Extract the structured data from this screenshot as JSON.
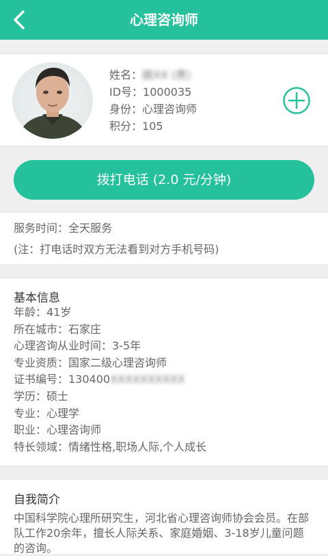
{
  "header": {
    "title": "心理咨询师"
  },
  "profile": {
    "name_label": "姓名：",
    "name_value": "姚XX (男)",
    "id_label": "ID号：",
    "id_value": "1000035",
    "identity_label": "身份：",
    "identity_value": "心理咨询师",
    "points_label": "积分：",
    "points_value": "105"
  },
  "call_button": {
    "label": "拨打电话 (2.0 元/分钟)"
  },
  "service": {
    "time_line": "服务时间：全天服务",
    "note_line": "(注：打电话时双方无法看到对方手机号码)"
  },
  "basic_info": {
    "title": "基本信息",
    "age": "年龄：41岁",
    "city": "所在城市：石家庄",
    "experience": "心理咨询从业时间：3-5年",
    "qualification": "专业资质：国家二级心理咨询师",
    "cert_label": "证书编号：130400",
    "cert_hidden": "XXXXXXXXXX",
    "education": "学历：硕士",
    "major": "专业：心理学",
    "occupation": "职业：心理咨询师",
    "specialty": "特长领域：情绪性格,职场人际,个人成长"
  },
  "intro": {
    "title": "自我简介",
    "text": "中国科学院心理所研究生，河北省心理咨询师协会会员。在部队工作20余年，擅长人际关系、家庭婚姻、3-18岁儿童问题的咨询。"
  },
  "colors": {
    "accent": "#25c09c",
    "background": "#efefef"
  }
}
